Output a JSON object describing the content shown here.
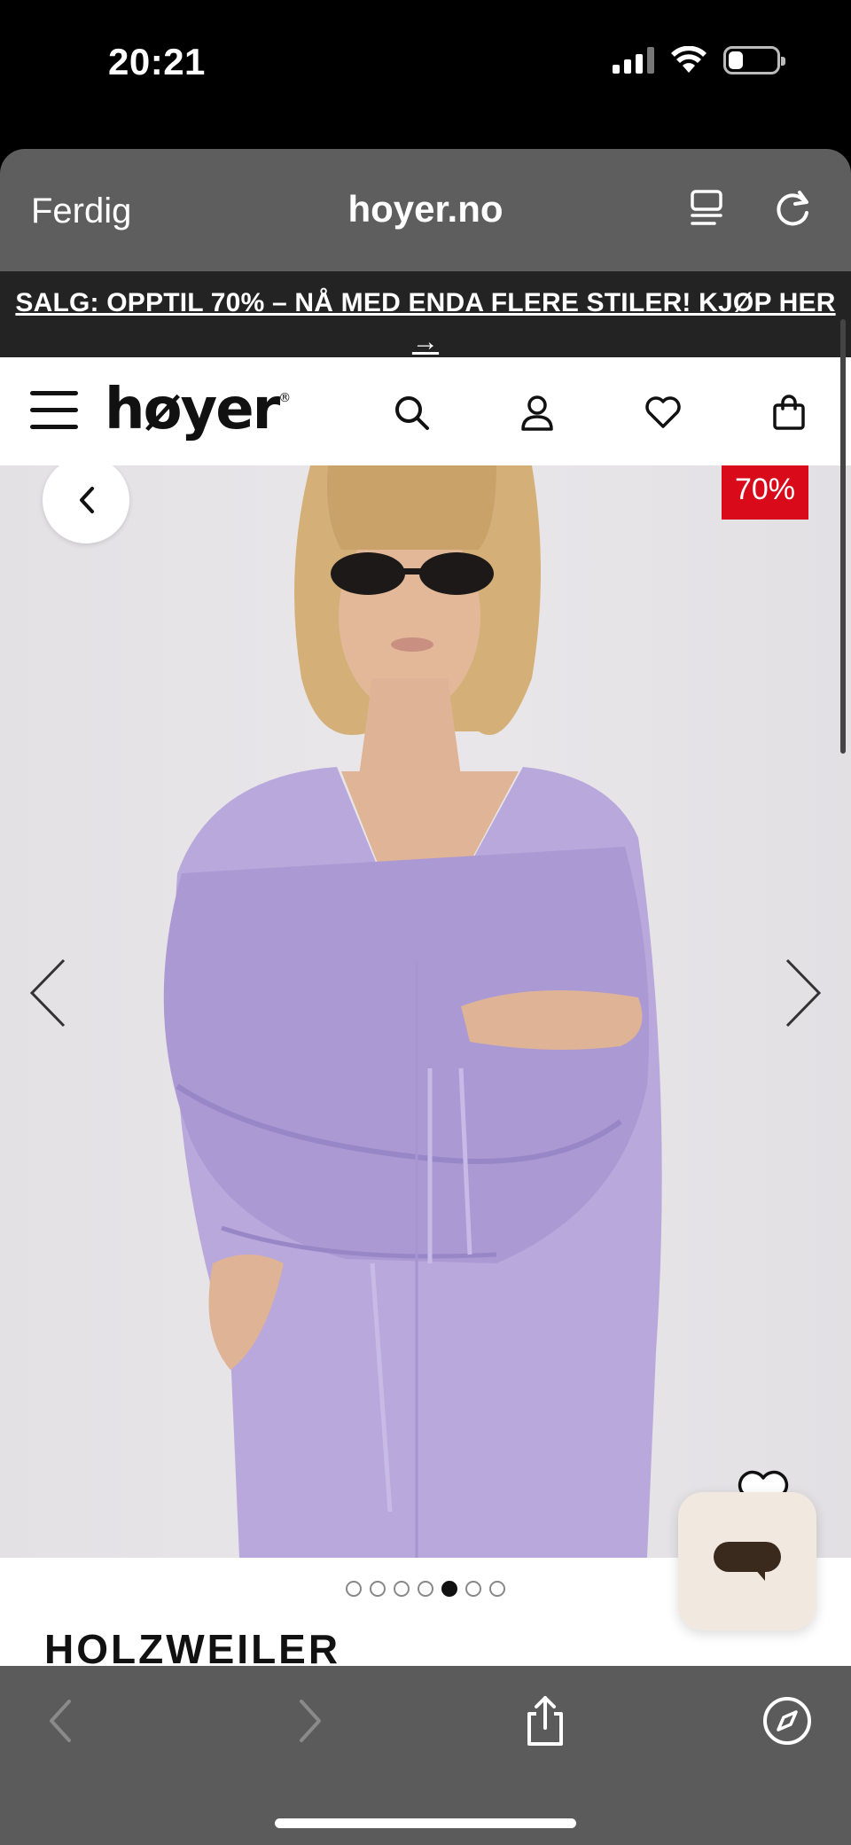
{
  "status_bar": {
    "time": "20:21"
  },
  "browser": {
    "done_label": "Ferdig",
    "url": "hoyer.no"
  },
  "promo": {
    "text": "SALG: OPPTIL 70% – NÅ MED ENDA FLERE STILER! KJØP HER →"
  },
  "site": {
    "logo_text": "høyer",
    "logo_mark": "®"
  },
  "product": {
    "discount_badge": "70%",
    "brand": "HOLZWEILER",
    "image_count": 7,
    "active_image_index": 4
  },
  "colors": {
    "badge_red": "#d90a1a",
    "dress_lilac": "#b8a8dc",
    "chat_bg": "#f1e8e0"
  }
}
